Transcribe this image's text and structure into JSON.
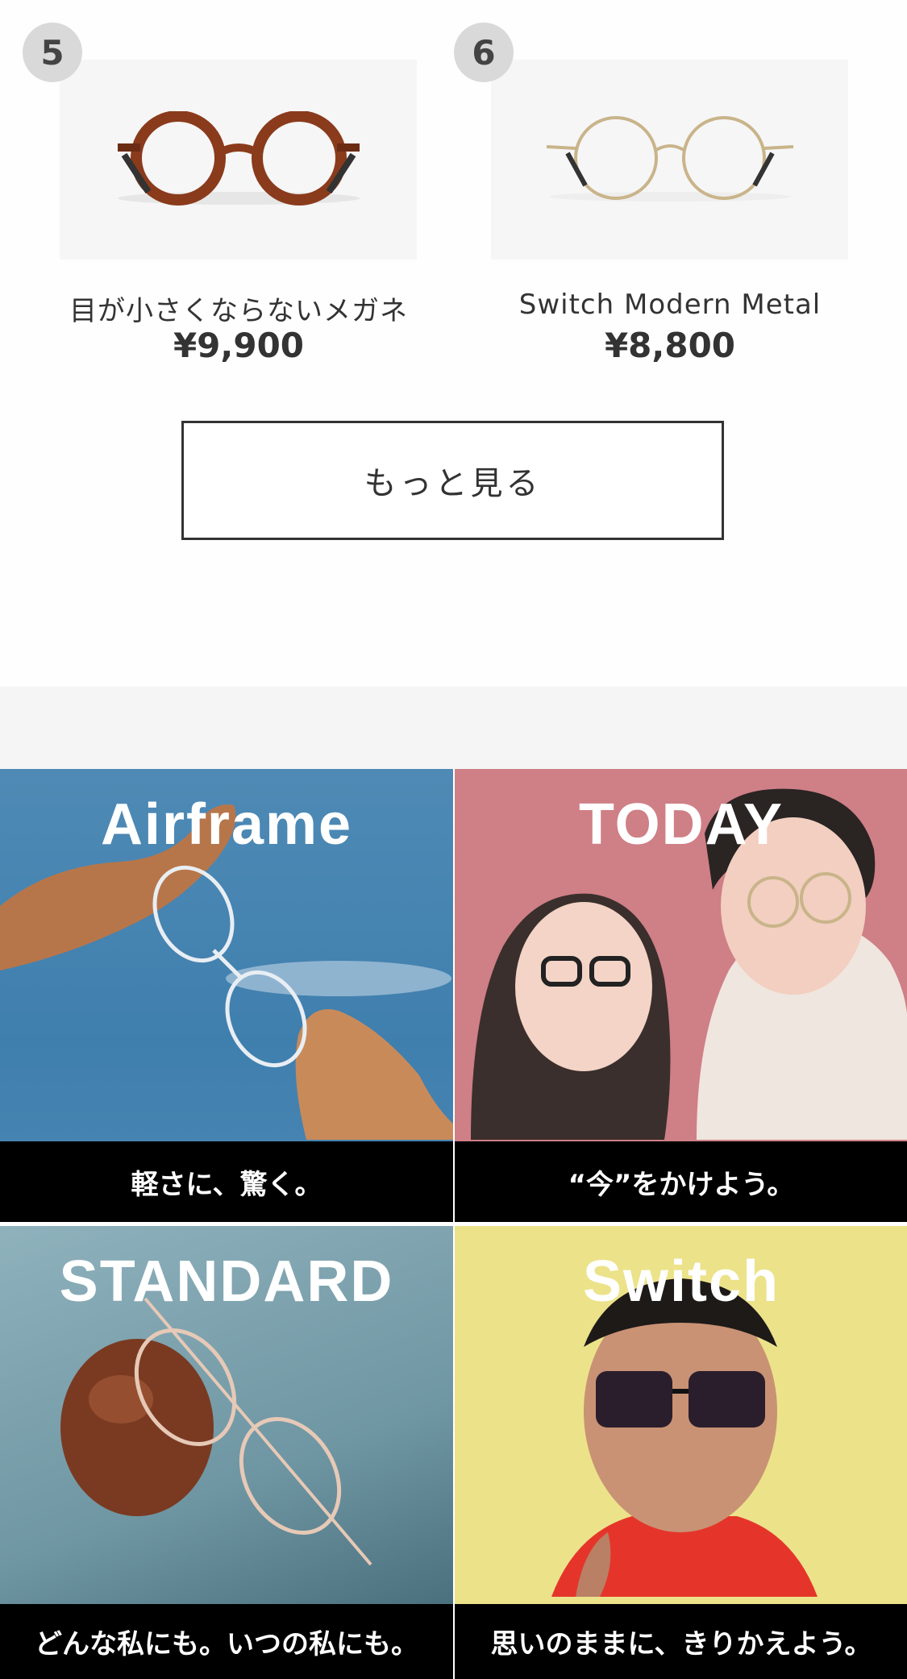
{
  "products": [
    {
      "rank": "5",
      "name": "目が小さくならないメガネ",
      "price": "¥9,900",
      "frame_color": "#8a3b1c"
    },
    {
      "rank": "6",
      "name": "Switch Modern Metal",
      "price": "¥8,800",
      "frame_color": "#c9b48a"
    }
  ],
  "more_button": {
    "label": "もっと見る"
  },
  "banners": [
    {
      "title": "Airframe",
      "caption": "軽さに、驚く。",
      "bg": "#4a86b4"
    },
    {
      "title": "TODAY",
      "caption": "“今”をかけよう。",
      "bg": "#cf7f86"
    },
    {
      "title": "STANDARD",
      "caption": "どんな私にも。いつの私にも。",
      "bg": "#7fa3ae"
    },
    {
      "title": "Switch",
      "caption": "思いのままに、きりかえよう。",
      "bg": "#ece28a"
    }
  ]
}
